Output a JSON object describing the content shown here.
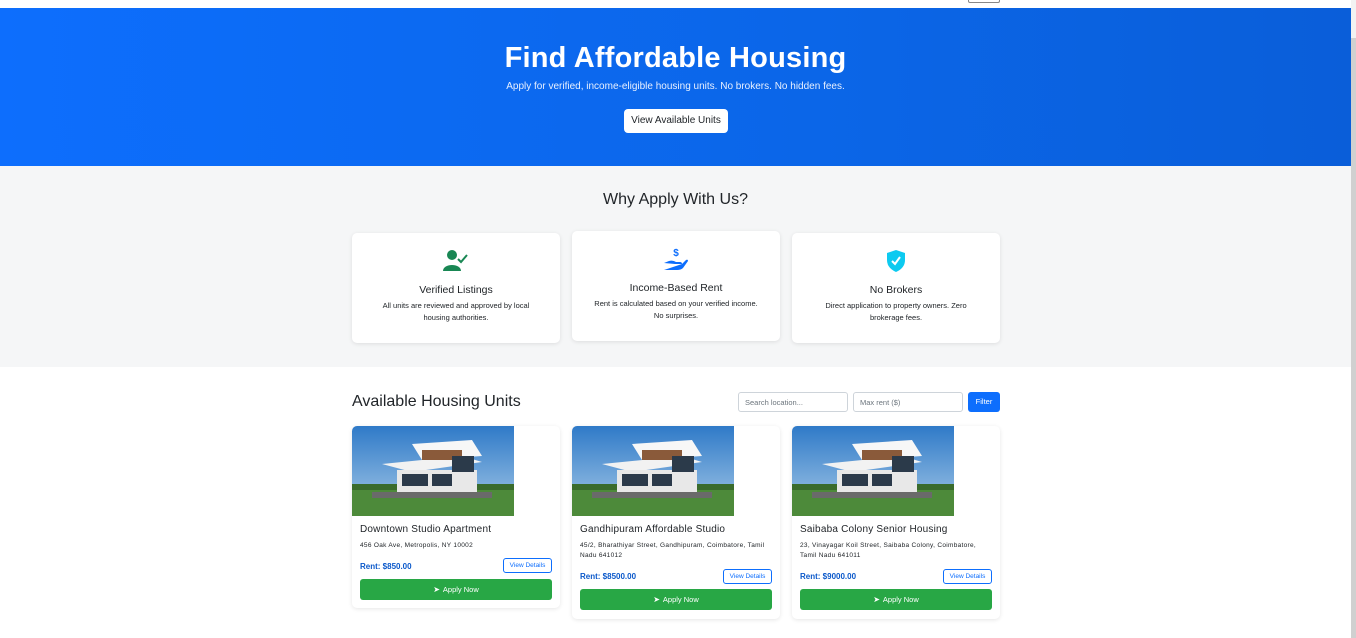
{
  "hero": {
    "title": "Find Affordable Housing",
    "subtitle": "Apply for verified, income-eligible housing units. No brokers. No hidden fees.",
    "cta_label": "View Available Units",
    "color": "#0d6efd"
  },
  "why": {
    "heading": "Why Apply With Us?",
    "features": [
      {
        "icon": "user-check-icon",
        "title": "Verified Listings",
        "desc": "All units are reviewed and approved by local housing authorities.",
        "color": "#198754"
      },
      {
        "icon": "hand-dollar-icon",
        "title": "Income-Based Rent",
        "desc": "Rent is calculated based on your verified income. No surprises.",
        "color": "#0d6efd"
      },
      {
        "icon": "shield-check-icon",
        "title": "No Brokers",
        "desc": "Direct application to property owners. Zero brokerage fees.",
        "color": "#0dcaf0"
      }
    ]
  },
  "units": {
    "heading": "Available Housing Units",
    "search_placeholder": "Search location...",
    "rent_placeholder": "Max rent ($)",
    "filter_label": "Filter",
    "details_label": "View Details",
    "apply_label": "Apply Now",
    "items": [
      {
        "title": "Downtown Studio Apartment",
        "address": "456 Oak Ave, Metropolis, NY 10002",
        "rent": "Rent: $850.00"
      },
      {
        "title": "Gandhipuram Affordable Studio",
        "address": "45/2, Bharathiyar Street, Gandhipuram, Coimbatore, Tamil Nadu 641012",
        "rent": "Rent: $8500.00"
      },
      {
        "title": "Saibaba Colony Senior Housing",
        "address": "23, Vinayagar Koil Street, Saibaba Colony, Coimbatore, Tamil Nadu 641011",
        "rent": "Rent: $9000.00"
      }
    ],
    "colors": {
      "apply": "#28a745",
      "accent": "#0d6efd"
    }
  }
}
